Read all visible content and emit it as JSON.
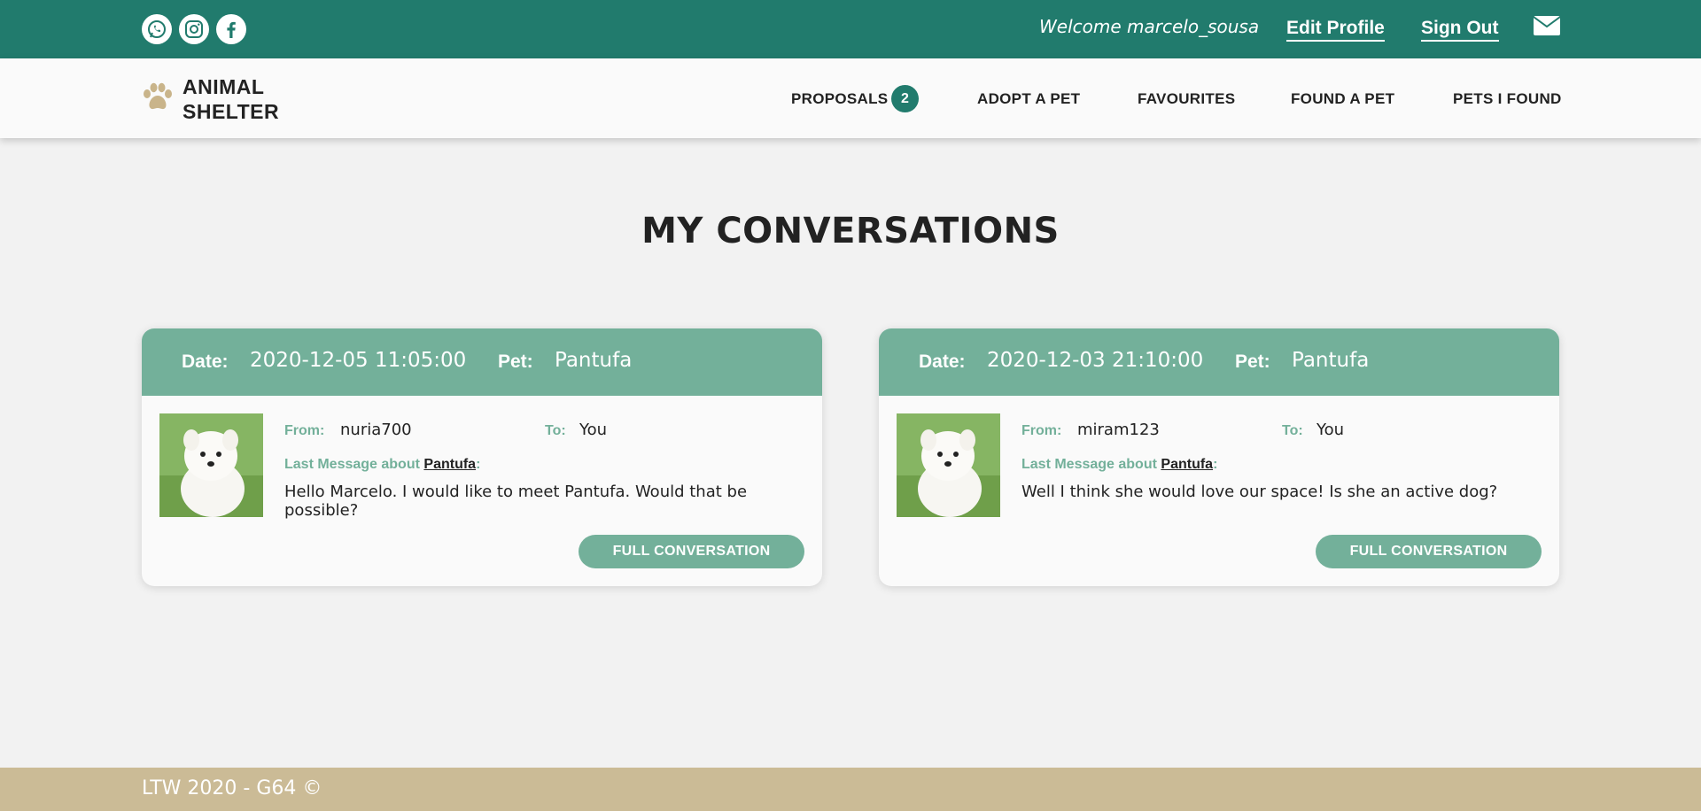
{
  "topbar": {
    "social": [
      "whatsapp-icon",
      "instagram-icon",
      "facebook-icon"
    ],
    "welcome": "Welcome marcelo_sousa",
    "edit_profile": "Edit Profile",
    "sign_out": "Sign Out",
    "mail_icon": "envelope-icon"
  },
  "brand": {
    "line1": "ANIMAL",
    "line2": "SHELTER",
    "icon": "paw-icon"
  },
  "nav": {
    "proposals": "PROPOSALS",
    "proposals_count": "2",
    "adopt": "ADOPT A PET",
    "favourites": "FAVOURITES",
    "found": "FOUND A PET",
    "pets_found": "PETS I FOUND"
  },
  "page_title": "MY CONVERSATIONS",
  "labels": {
    "date": "Date:",
    "pet": "Pet:",
    "from": "From:",
    "to": "To:",
    "last_message_about": "Last Message about",
    "button": "FULL CONVERSATION"
  },
  "conversations": [
    {
      "date": "2020-12-05 11:05:00",
      "pet": "Pantufa",
      "from": "nuria700",
      "to": "You",
      "last_pet": "Pantufa",
      "message": "Hello Marcelo. I would like to meet Pantufa. Would that be possible?"
    },
    {
      "date": "2020-12-03 21:10:00",
      "pet": "Pantufa",
      "from": "miram123",
      "to": "You",
      "last_pet": "Pantufa",
      "message": "Well I think she would love our space! Is she an active dog?"
    }
  ],
  "footer": {
    "text": "LTW 2020 - G64 ©"
  },
  "colors": {
    "topbar": "#217b6d",
    "card_header": "#73b09a",
    "footer": "#cbbb96",
    "paw": "#c9b48a"
  }
}
